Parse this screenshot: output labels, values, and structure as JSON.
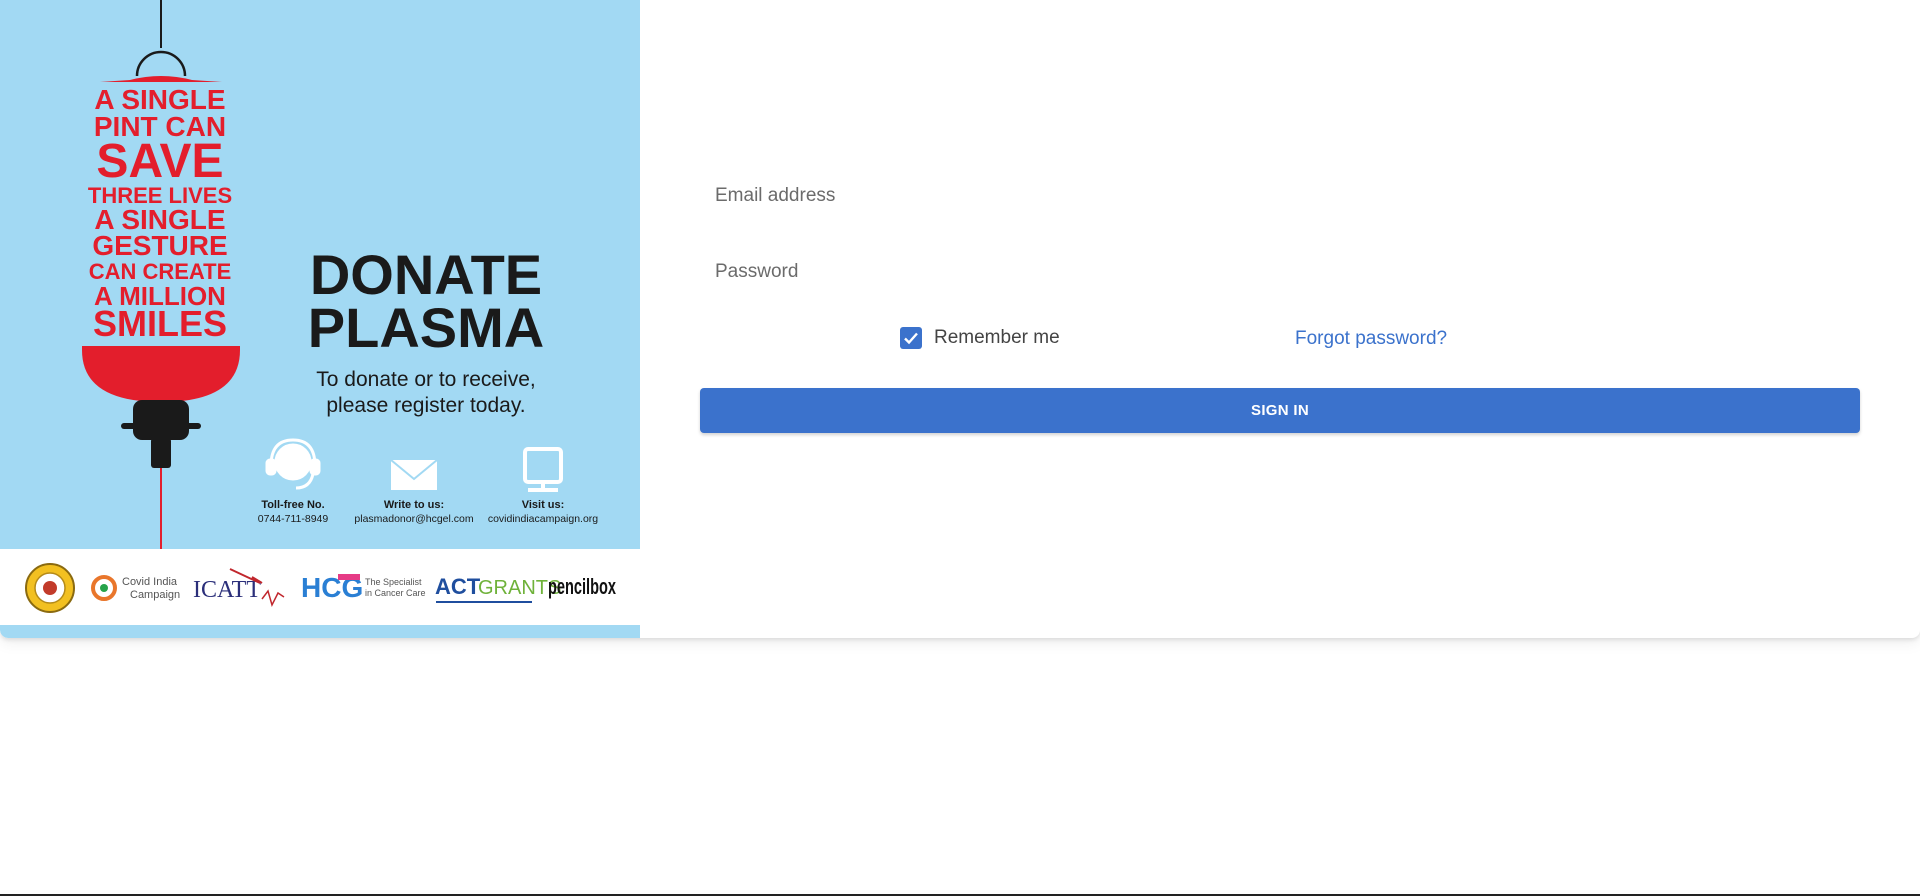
{
  "poster": {
    "slogan": [
      "A SINGLE",
      "PINT CAN",
      "SAVE",
      "THREE LIVES",
      "A SINGLE",
      "GESTURE",
      "CAN CREATE",
      "A MILLION",
      "SMILES"
    ],
    "title_line1": "DONATE",
    "title_line2": "PLASMA",
    "subtitle_line1": "To donate or to receive,",
    "subtitle_line2": "please register today.",
    "contacts": [
      {
        "icon": "headset-icon",
        "label": "Toll-free No.",
        "value": "0744-711-8949"
      },
      {
        "icon": "envelope-icon",
        "label": "Write to us:",
        "value": "plasmadonor@hcgel.com"
      },
      {
        "icon": "monitor-icon",
        "label": "Visit us:",
        "value": "covidindiacampaign.org"
      }
    ],
    "sponsors": {
      "covid_line1": "Covid India",
      "covid_line2": "Campaign",
      "icatt": "ICATT",
      "hcg": "HCG",
      "hcg_line1": "The Specialist",
      "hcg_line2": "in Cancer Care",
      "act_left": "ACT",
      "act_right": "GRANTS",
      "pencilbox": "pencilbox"
    },
    "colors": {
      "background": "#a2d9f3",
      "accent_red": "#e31e2c",
      "dark": "#1a1a1a"
    }
  },
  "form": {
    "email_placeholder": "Email address",
    "password_placeholder": "Password",
    "remember_label": "Remember me",
    "remember_checked": true,
    "forgot_label": "Forgot password?",
    "signin_label": "SIGN IN"
  },
  "colors": {
    "primary": "#3b72cc"
  }
}
